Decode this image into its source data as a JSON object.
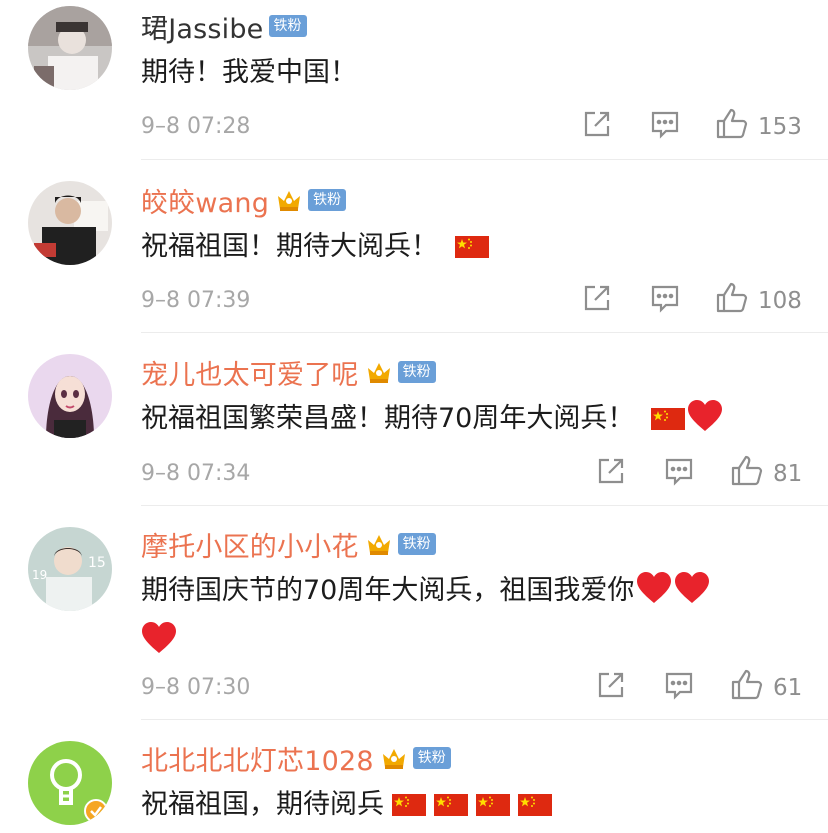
{
  "badge_label": "铁粉",
  "comments": [
    {
      "username": "珺Jassibe",
      "vip": false,
      "text": "期待！我爱中国！",
      "time": "9–8 07:28",
      "likes": "153"
    },
    {
      "username": "皎皎wang",
      "vip": true,
      "text": "祝福祖国！期待大阅兵！",
      "emoji": [
        "cn-flag"
      ],
      "time": "9–8 07:39",
      "likes": "108"
    },
    {
      "username": "宠儿也太可爱了呢",
      "vip": true,
      "text": "祝福祖国繁荣昌盛！期待70周年大阅兵！",
      "emoji": [
        "cn-flag",
        "red-heart"
      ],
      "time": "9–8 07:34",
      "likes": "81"
    },
    {
      "username": "摩托小区的小小花",
      "vip": true,
      "text": "期待国庆节的70周年大阅兵，祖国我爱你",
      "emoji": [
        "red-heart",
        "red-heart",
        "red-heart"
      ],
      "time": "9–8 07:30",
      "likes": "61"
    },
    {
      "username": "北北北北灯芯1028",
      "vip": true,
      "text": "祝福祖国，期待阅兵",
      "emoji": [
        "cn-flag",
        "cn-flag",
        "cn-flag",
        "cn-flag"
      ]
    }
  ],
  "colors": {
    "vip_name": "#eb7350",
    "badge_bg": "#6a9fd8",
    "meta_text": "#a7a7a7",
    "heart": "#e8232c",
    "flag_red": "#de2910",
    "flag_star": "#ffde00"
  }
}
